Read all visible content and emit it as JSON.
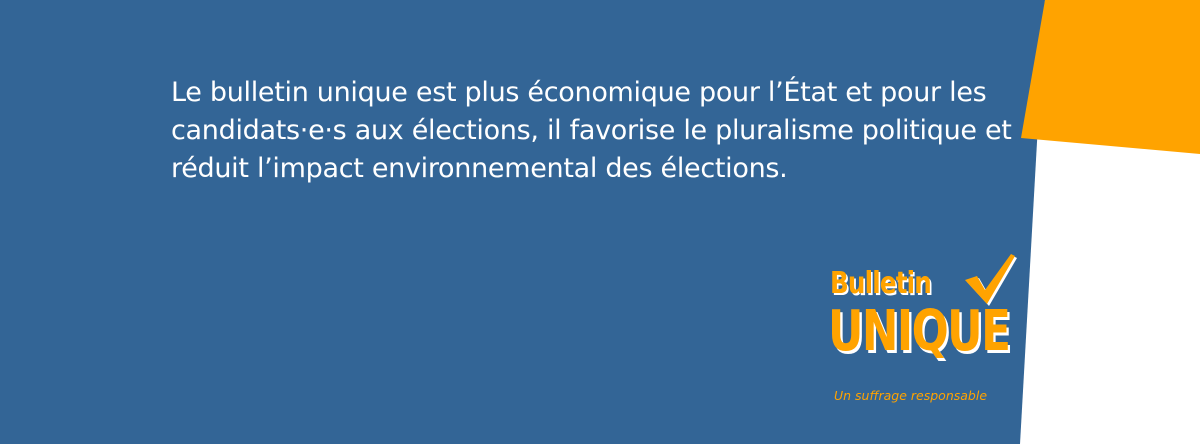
{
  "colors": {
    "background_blue": "#336596",
    "accent_orange": "#ffa300",
    "white": "#ffffff"
  },
  "quote": {
    "text": "Le bulletin unique est plus économique pour l’État et pour les candidats·e·s aux élections, il favorise le pluralisme politique et réduit l’impact environnemental des élections."
  },
  "logo": {
    "line1": "Bulletin",
    "line2": "UNIQUE",
    "tagline": "Un suffrage responsable",
    "icon": "checkmark-icon"
  }
}
